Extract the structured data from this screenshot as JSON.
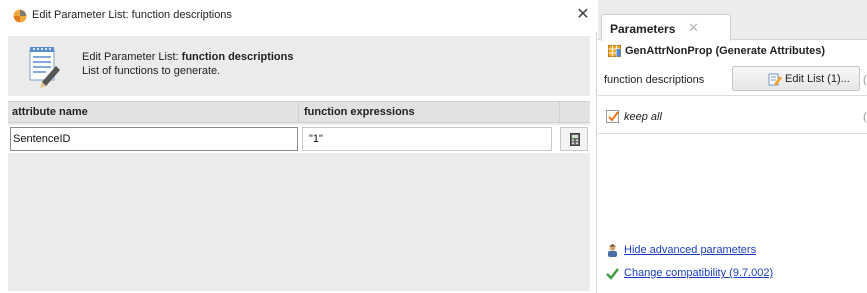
{
  "dialog": {
    "title": "Edit Parameter List: function descriptions",
    "close_glyph": "✕",
    "header_title_prefix": "Edit Parameter List: ",
    "header_title_bold": "function descriptions",
    "header_description": "List of functions to generate."
  },
  "table": {
    "columns": [
      "attribute name",
      "function expressions"
    ],
    "rows": [
      {
        "attribute_name": "SentenceID",
        "function_expression": "\"1\""
      }
    ]
  },
  "params_panel": {
    "tab_label": "Parameters",
    "tab_close_glyph": "✕",
    "operator_name": "GenAttrNonProp (Generate Attributes)",
    "param_label": "function descriptions",
    "edit_list_label": "Edit List (1)...",
    "trunc_mark_1": "(",
    "keep_all_label": "keep all",
    "keep_all_checked": true,
    "trunc_mark_2": "(",
    "hide_advanced_link": "Hide advanced parameters",
    "compatibility_link": "Change compatibility (9.7.002)"
  },
  "icons": {
    "title_icon": "rapidminer-logo-icon",
    "header_icon": "notepad-pencil-icon",
    "calc_icon": "calculator-icon",
    "operator_icon": "generate-attributes-icon",
    "edit_list_icon": "edit-list-icon",
    "checkbox_icon": "checkmark-icon",
    "advanced_icon": "user-wizard-icon",
    "compat_icon": "green-check-icon"
  },
  "colors": {
    "link": "#1a3fbf",
    "header_bg": "#ebebeb",
    "check": "#e8741a",
    "compat_check": "#3a9a3a"
  }
}
